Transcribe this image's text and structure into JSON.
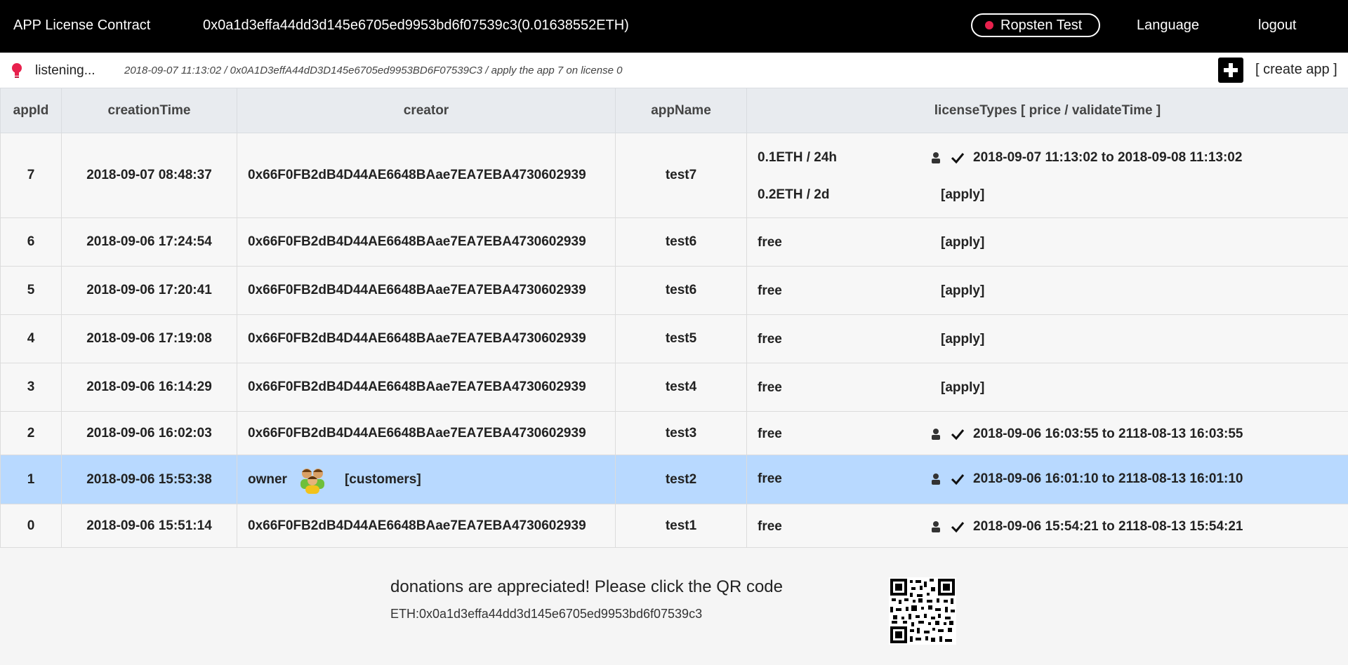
{
  "header": {
    "title": "APP License Contract",
    "contract": "0x0a1d3effa44dd3d145e6705ed9953bd6f07539c3(0.01638552ETH)",
    "network": "Ropsten Test",
    "language": "Language",
    "logout": "logout"
  },
  "status": {
    "listening": "listening...",
    "event": "2018-09-07 11:13:02 / 0x0A1D3effA44dD3D145e6705ed9953BD6F07539C3 / apply the app 7 on license 0",
    "create_app": "[ create app ]"
  },
  "table": {
    "headers": [
      "appId",
      "creationTime",
      "creator",
      "appName",
      "licenseTypes [ price / validateTime ]"
    ],
    "rows": [
      {
        "appId": "7",
        "creationTime": "2018-09-07 08:48:37",
        "creator": "0x66F0FB2dB4D44AE6648BAae7EA7EBA4730602939",
        "appName": "test7",
        "licenses": [
          {
            "price": "0.1ETH / 24h",
            "range": "2018-09-07 11:13:02 to 2018-09-08 11:13:02"
          },
          {
            "price": "0.2ETH / 2d",
            "apply": "[apply]"
          }
        ]
      },
      {
        "appId": "6",
        "creationTime": "2018-09-06 17:24:54",
        "creator": "0x66F0FB2dB4D44AE6648BAae7EA7EBA4730602939",
        "appName": "test6",
        "licenses": [
          {
            "price": "free",
            "apply": "[apply]"
          }
        ]
      },
      {
        "appId": "5",
        "creationTime": "2018-09-06 17:20:41",
        "creator": "0x66F0FB2dB4D44AE6648BAae7EA7EBA4730602939",
        "appName": "test6",
        "licenses": [
          {
            "price": "free",
            "apply": "[apply]"
          }
        ]
      },
      {
        "appId": "4",
        "creationTime": "2018-09-06 17:19:08",
        "creator": "0x66F0FB2dB4D44AE6648BAae7EA7EBA4730602939",
        "appName": "test5",
        "licenses": [
          {
            "price": "free",
            "apply": "[apply]"
          }
        ]
      },
      {
        "appId": "3",
        "creationTime": "2018-09-06 16:14:29",
        "creator": "0x66F0FB2dB4D44AE6648BAae7EA7EBA4730602939",
        "appName": "test4",
        "licenses": [
          {
            "price": "free",
            "apply": "[apply]"
          }
        ]
      },
      {
        "appId": "2",
        "creationTime": "2018-09-06 16:02:03",
        "creator": "0x66F0FB2dB4D44AE6648BAae7EA7EBA4730602939",
        "appName": "test3",
        "licenses": [
          {
            "price": "free",
            "range": "2018-09-06 16:03:55 to 2118-08-13 16:03:55"
          }
        ]
      },
      {
        "appId": "1",
        "creationTime": "2018-09-06 15:53:38",
        "creator": "owner",
        "customers": "[customers]",
        "appName": "test2",
        "licenses": [
          {
            "price": "free",
            "range": "2018-09-06 16:01:10 to 2118-08-13 16:01:10"
          }
        ]
      },
      {
        "appId": "0",
        "creationTime": "2018-09-06 15:51:14",
        "creator": "0x66F0FB2dB4D44AE6648BAae7EA7EBA4730602939",
        "appName": "test1",
        "licenses": [
          {
            "price": "free",
            "range": "2018-09-06 15:54:21 to 2118-08-13 15:54:21"
          }
        ]
      }
    ]
  },
  "footer": {
    "donate": "donations are appreciated! Please click the QR code",
    "eth": "ETH:0x0a1d3effa44dd3d145e6705ed9953bd6f07539c3"
  },
  "colors": {
    "topbar": "#000000",
    "network_dot": "#e8214d",
    "highlight_row": "#b8d9ff",
    "header_bg": "#e8ebef"
  },
  "icons": [
    "bulb-icon",
    "plus-icon",
    "person-icon",
    "check-icon",
    "people-icon",
    "qr-code"
  ]
}
